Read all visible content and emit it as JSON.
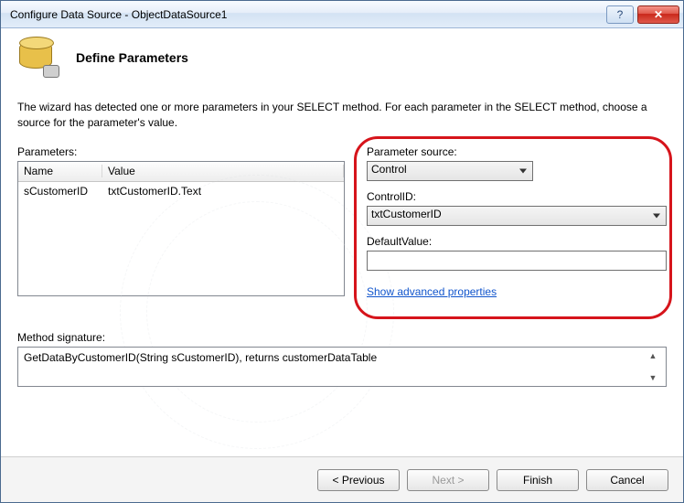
{
  "window": {
    "title": "Configure Data Source - ObjectDataSource1"
  },
  "header": {
    "title": "Define Parameters"
  },
  "description": "The wizard has detected one or more parameters in your SELECT method. For each parameter in the SELECT method, choose a source for the parameter's value.",
  "parameters": {
    "label": "Parameters:",
    "columns": {
      "name": "Name",
      "value": "Value"
    },
    "rows": [
      {
        "name": "sCustomerID",
        "value": "txtCustomerID.Text"
      }
    ]
  },
  "right_panel": {
    "parameter_source_label": "Parameter source:",
    "parameter_source_value": "Control",
    "control_id_label": "ControlID:",
    "control_id_value": "txtCustomerID",
    "default_value_label": "DefaultValue:",
    "default_value_value": "",
    "advanced_link": "Show advanced properties"
  },
  "method": {
    "label": "Method signature:",
    "signature": "GetDataByCustomerID(String sCustomerID), returns customerDataTable"
  },
  "footer": {
    "previous": "< Previous",
    "next": "Next >",
    "finish": "Finish",
    "cancel": "Cancel"
  }
}
